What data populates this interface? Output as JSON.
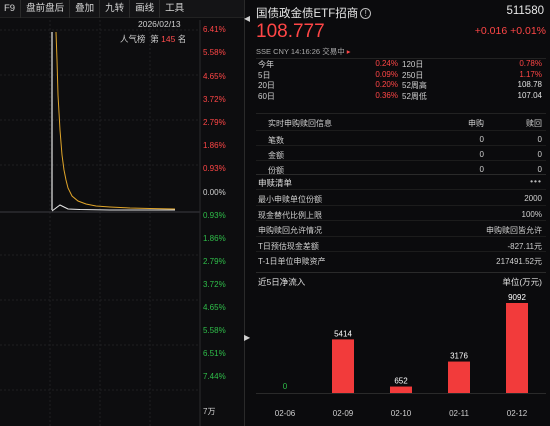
{
  "toolbar": {
    "items": [
      "F9",
      "盘前盘后",
      "叠加",
      "九转",
      "画线",
      "工具"
    ]
  },
  "intraday": {
    "date": "2026/02/13",
    "rank_prefix": "人气榜",
    "rank_label": "第",
    "rank_value": "145",
    "rank_suffix": "名",
    "pct_up": [
      "6.41%",
      "5.58%",
      "4.65%",
      "3.72%",
      "2.79%",
      "1.86%",
      "0.93%"
    ],
    "pct_zero": "0.00%",
    "pct_down": [
      "0.93%",
      "1.86%",
      "2.79%",
      "3.72%",
      "4.65%",
      "5.58%",
      "6.51%",
      "7.44%"
    ],
    "volume_unit": "7万"
  },
  "quote": {
    "name": "国债政金债ETF招商",
    "info_icon": "!",
    "code": "511580",
    "price": "108.777",
    "change": "+0.016",
    "change_pct": "+0.01%",
    "exchange": "SSE",
    "currency": "CNY",
    "time": "14:16:26",
    "status": "交易中",
    "up_color": "#ff4646",
    "down_color": "#2fbf4a"
  },
  "performance": [
    {
      "l1": "今年",
      "v1": "0.24%",
      "l2": "120日",
      "v2": "0.78%"
    },
    {
      "l1": "5日",
      "v1": "0.09%",
      "l2": "250日",
      "v2": "1.17%"
    },
    {
      "l1": "20日",
      "v1": "0.20%",
      "l2": "52周高",
      "v2": "108.78"
    },
    {
      "l1": "60日",
      "v1": "0.36%",
      "l2": "52周低",
      "v2": "107.04"
    }
  ],
  "realtime_sr": {
    "header": [
      "实时申购赎回信息",
      "申购",
      "赎回"
    ],
    "rows": [
      {
        "label": "笔数",
        "sub": "0",
        "red": "0"
      },
      {
        "label": "金额",
        "sub": "0",
        "red": "0"
      },
      {
        "label": "份额",
        "sub": "0",
        "red": "0"
      }
    ]
  },
  "sr_list": {
    "title": "申赎清单",
    "more": "•••",
    "rows": [
      {
        "label": "最小申赎单位份额",
        "value": "2000"
      },
      {
        "label": "现金替代比例上限",
        "value": "100%"
      },
      {
        "label": "申购赎回允许情况",
        "value": "申购赎回皆允许"
      },
      {
        "label": "T日预估现金差额",
        "value": "-827.11元"
      },
      {
        "label": "T-1日单位申赎资产",
        "value": "217491.52元"
      }
    ]
  },
  "chart_data": {
    "type": "bar",
    "title": "近5日净流入",
    "ylabel": "单位(万元)",
    "categories": [
      "02-06",
      "02-09",
      "02-10",
      "02-11",
      "02-12"
    ],
    "values": [
      0,
      5414,
      652,
      3176,
      9092
    ],
    "value_labels": [
      "0",
      "5414",
      "652",
      "3176",
      "9092"
    ],
    "bar_color": "#f23b3b",
    "label_colors": [
      "#2fbf4a",
      "#ffffff",
      "#ffffff",
      "#ffffff",
      "#ffffff"
    ]
  }
}
